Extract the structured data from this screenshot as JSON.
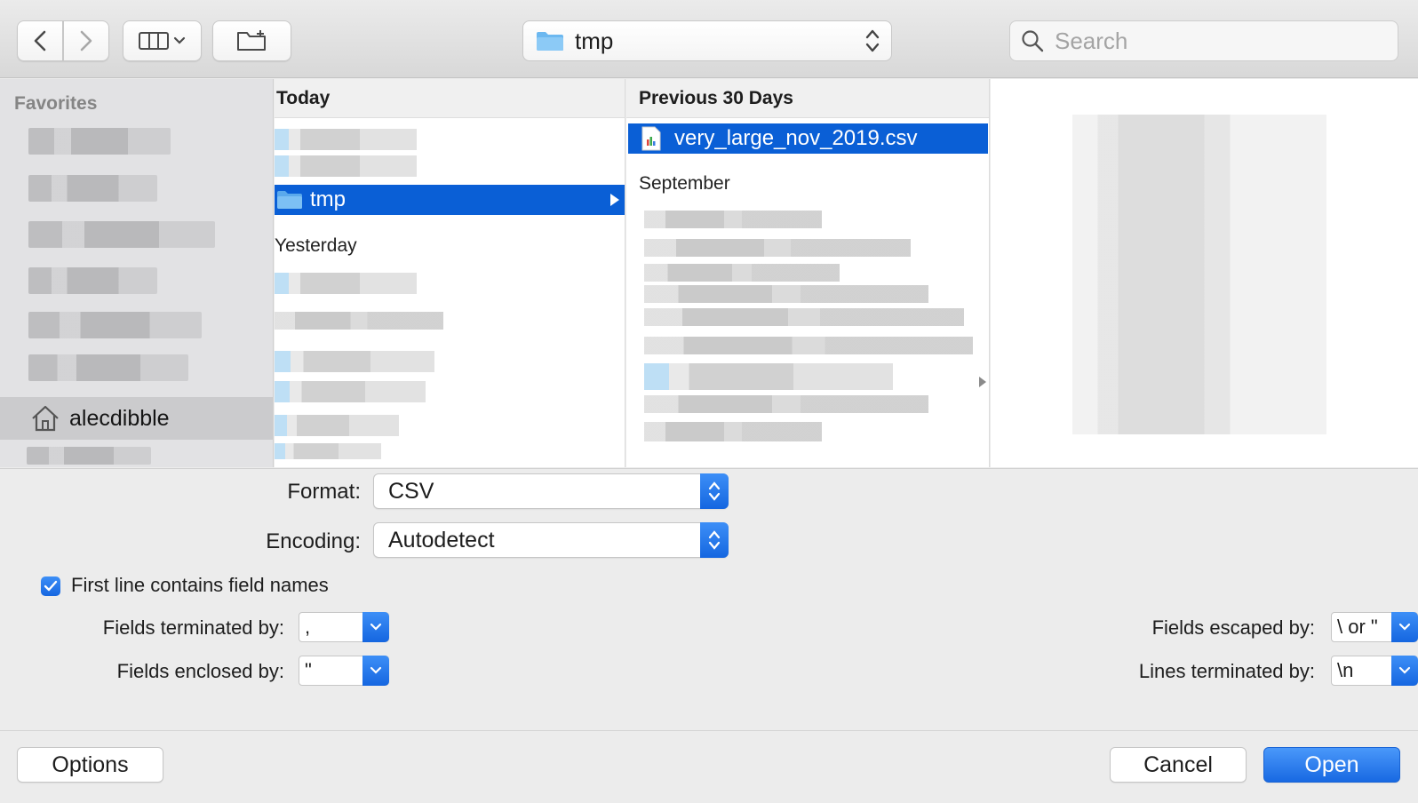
{
  "toolbar": {
    "back_icon": "chevron-left-icon",
    "forward_icon": "chevron-right-icon",
    "view_icon": "column-view-icon",
    "new_folder_icon": "new-folder-icon",
    "location": "tmp",
    "search_placeholder": "Search"
  },
  "sidebar": {
    "heading": "Favorites",
    "home_item": "alecdibble"
  },
  "columns": {
    "col1": {
      "header": "Today",
      "selected_item": "tmp",
      "section_yesterday": "Yesterday"
    },
    "col2": {
      "header": "Previous 30 Days",
      "selected_file": "very_large_nov_2019.csv",
      "section_september": "September"
    }
  },
  "options": {
    "format_label": "Format:",
    "format_value": "CSV",
    "encoding_label": "Encoding:",
    "encoding_value": "Autodetect",
    "first_line_label": "First line contains field names",
    "first_line_checked": true,
    "fields_terminated_label": "Fields terminated by:",
    "fields_terminated_value": ",",
    "fields_enclosed_label": "Fields enclosed by:",
    "fields_enclosed_value": "\"",
    "fields_escaped_label": "Fields escaped by:",
    "fields_escaped_value": "\\ or \"",
    "lines_terminated_label": "Lines terminated by:",
    "lines_terminated_value": "\\n"
  },
  "buttons": {
    "options": "Options",
    "cancel": "Cancel",
    "open": "Open"
  },
  "colors": {
    "accent": "#0a5fd6",
    "primary_button": "#1869e2"
  }
}
